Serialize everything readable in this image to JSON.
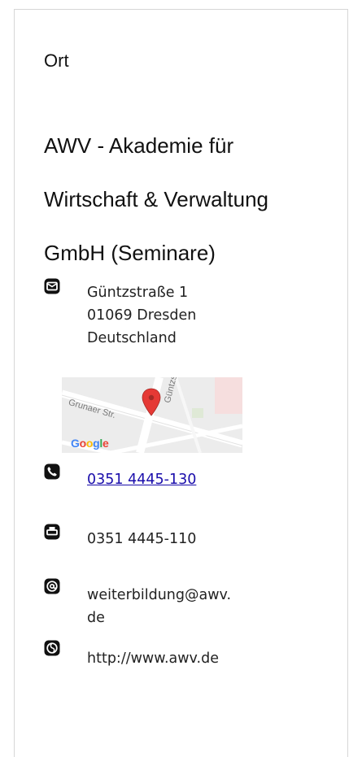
{
  "section": {
    "heading": "Ort",
    "org_lines": [
      "AWV - Akademie für",
      "Wirtschaft & Verwaltung",
      "GmbH (Seminare)"
    ]
  },
  "address": {
    "icon": "envelope-icon",
    "lines": [
      "Güntzstraße 1",
      "01069 Dresden",
      "Deutschland"
    ]
  },
  "map": {
    "logo": "Google",
    "street_1": "Grunaer Str.",
    "street_2": "Güntzstra",
    "pin_color": "#e53935"
  },
  "contact": {
    "phone_icon": "phone-icon",
    "phone": "0351 4445-130",
    "fax_icon": "printer-icon",
    "fax": "0351 4445-110",
    "email_icon": "at-sign-icon",
    "email_lines": [
      "weiterbildung@awv.",
      "de"
    ],
    "web_icon": "globe-icon",
    "website": "http://www.awv.de"
  },
  "colors": {
    "link": "#1a0dab",
    "icon": "#111111"
  }
}
